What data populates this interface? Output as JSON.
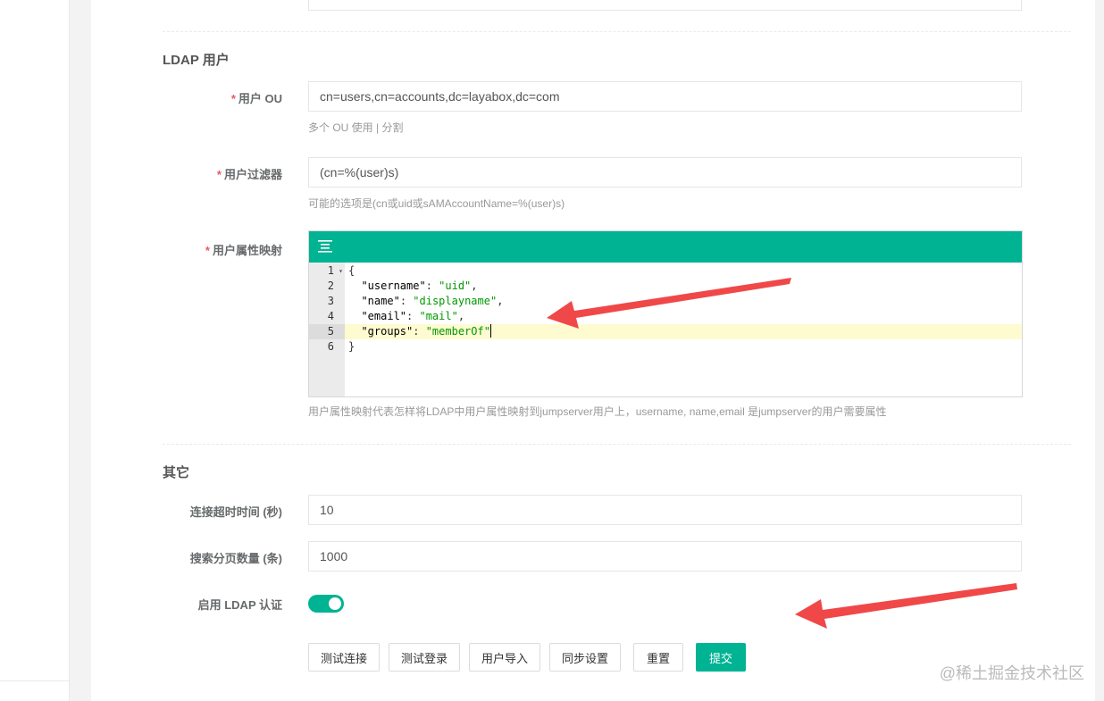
{
  "ldap_section": {
    "title": "LDAP 用户",
    "user_ou": {
      "label": "用户 OU",
      "value": "cn=users,cn=accounts,dc=layabox,dc=com",
      "help": "多个 OU 使用 | 分割"
    },
    "user_filter": {
      "label": "用户过滤器",
      "value": "(cn=%(user)s)",
      "help": "可能的选项是(cn或uid或sAMAccountName=%(user)s)"
    },
    "attr_map": {
      "label": "用户属性映射",
      "help": "用户属性映射代表怎样将LDAP中用户属性映射到jumpserver用户上，username, name,email 是jumpserver的用户需要属性",
      "line_numbers": [
        "1",
        "2",
        "3",
        "4",
        "5",
        "6"
      ],
      "lines": [
        [
          {
            "t": "p",
            "v": "{"
          }
        ],
        [
          {
            "t": "p",
            "v": "  "
          },
          {
            "t": "k",
            "v": "\"username\""
          },
          {
            "t": "p",
            "v": ": "
          },
          {
            "t": "s",
            "v": "\"uid\""
          },
          {
            "t": "p",
            "v": ","
          }
        ],
        [
          {
            "t": "p",
            "v": "  "
          },
          {
            "t": "k",
            "v": "\"name\""
          },
          {
            "t": "p",
            "v": ": "
          },
          {
            "t": "s",
            "v": "\"displayname\""
          },
          {
            "t": "p",
            "v": ","
          }
        ],
        [
          {
            "t": "p",
            "v": "  "
          },
          {
            "t": "k",
            "v": "\"email\""
          },
          {
            "t": "p",
            "v": ": "
          },
          {
            "t": "s",
            "v": "\"mail\""
          },
          {
            "t": "p",
            "v": ","
          }
        ],
        [
          {
            "t": "p",
            "v": "  "
          },
          {
            "t": "k",
            "v": "\"groups\""
          },
          {
            "t": "p",
            "v": ": "
          },
          {
            "t": "s",
            "v": "\"memberOf\""
          }
        ],
        [
          {
            "t": "p",
            "v": "}"
          }
        ]
      ],
      "active_line": 5
    }
  },
  "other_section": {
    "title": "其它",
    "timeout": {
      "label": "连接超时时间 (秒)",
      "value": "10"
    },
    "page_size": {
      "label": "搜索分页数量 (条)",
      "value": "1000"
    },
    "enable_ldap": {
      "label": "启用 LDAP 认证",
      "enabled": true
    }
  },
  "buttons": {
    "test_connection": "测试连接",
    "test_login": "测试登录",
    "import_users": "用户导入",
    "sync_settings": "同步设置",
    "reset": "重置",
    "submit": "提交"
  },
  "watermark": "@稀土掘金技术社区",
  "colors": {
    "accent": "#00b393",
    "required": "#ed5565",
    "annotation_arrow": "#f04848",
    "active_line_bg": "#fffbd1"
  }
}
